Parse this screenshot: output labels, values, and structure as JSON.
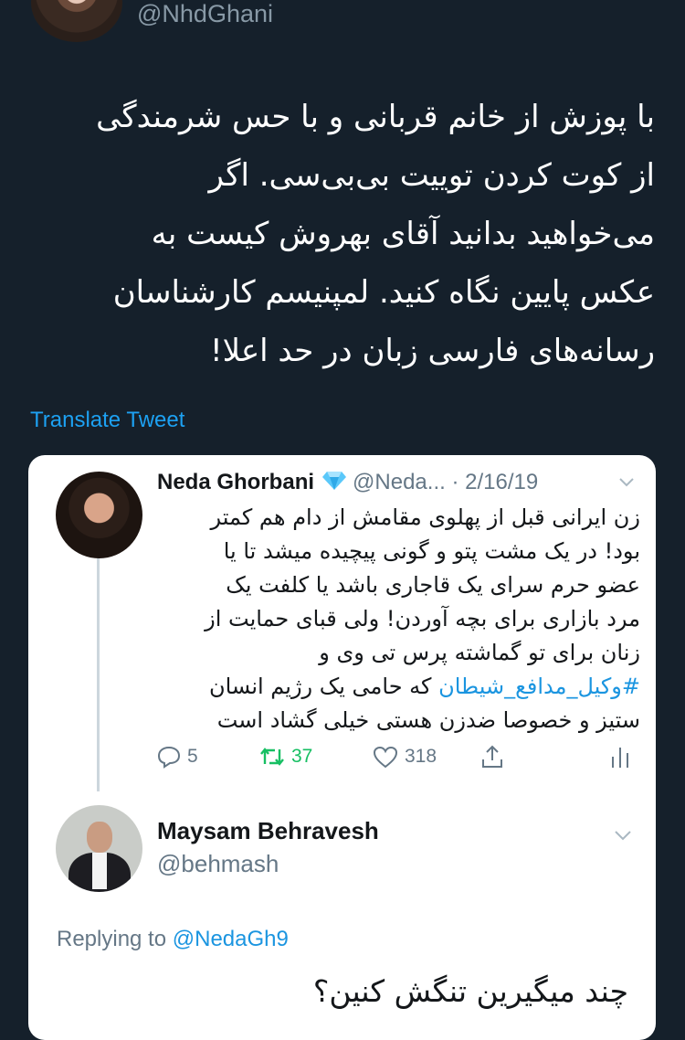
{
  "header": {
    "handle": "@NhdGhani"
  },
  "tweet": {
    "lines": [
      "با پوزش از خانم قربانی و با حس شرمندگی",
      "از کوت کردن توییت بی‌بی‌سی. اگر",
      "می‌خواهید بدانید آقای بهروش کیست به",
      "عکس پایین نگاه کنید. لمپنیسم کارشناسان",
      "رسانه‌های فارسی زبان در حد اعلا!"
    ],
    "translate_label": "Translate Tweet"
  },
  "quoted": {
    "name": "Neda Ghorbani",
    "handle": "@Neda...",
    "date": "· 2/16/19",
    "lines": [
      "زن ایرانی قبل از پهلوی مقامش از دام هم کمتر",
      "بود! در یک مشت پتو و گونی پیچیده میشد تا یا",
      "عضو حرم سرای یک قاجاری باشد یا کلفت یک",
      "مرد بازاری برای بچه آوردن! ولی قبای حمایت از",
      "زنان برای تو گماشته پرس تی وی و"
    ],
    "hashtag": "#وکیل_مدافع_شیطان",
    "hashtag_rest": " که حامی یک رژیم انسان",
    "last_line": "ستیز و خصوصا ضدزن هستی خیلی گشاد است",
    "replies": "5",
    "retweets": "37",
    "likes": "318"
  },
  "reply": {
    "name": "Maysam Behravesh",
    "handle": "@behmash",
    "replying_prefix": "Replying to ",
    "replying_to": "@NedaGh9",
    "text": "چند میگیرین تنگش کنین؟"
  },
  "colors": {
    "background": "#15202b",
    "link": "#1da1f2",
    "retweet": "#17bf63",
    "muted": "#657786"
  }
}
